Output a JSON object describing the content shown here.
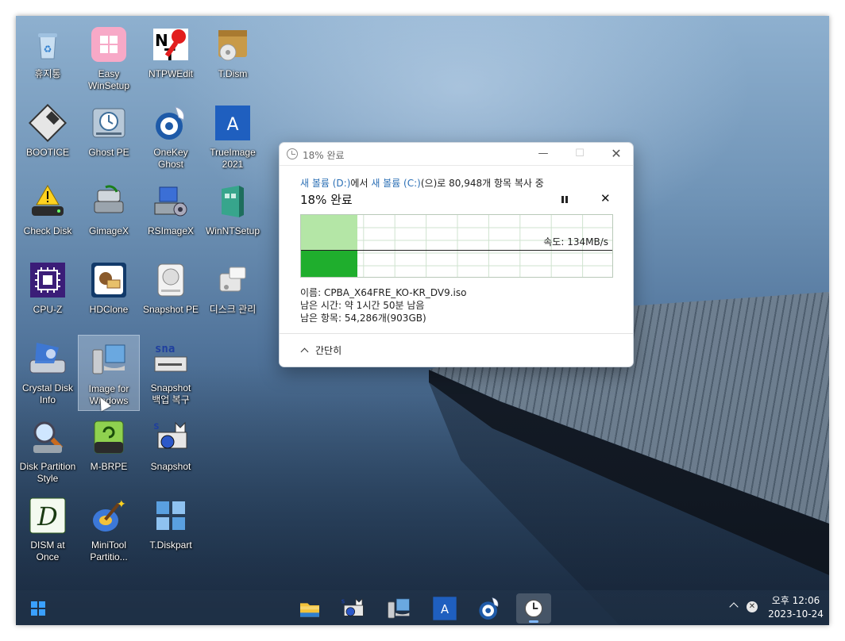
{
  "desktop": {
    "icons": [
      {
        "label": [
          "휴지통"
        ],
        "icon": "recycle-bin-icon"
      },
      {
        "label": [
          "Easy",
          "WinSetup"
        ],
        "icon": "windows-tile-icon"
      },
      {
        "label": [
          "NTPWEdit"
        ],
        "icon": "nt-key-icon"
      },
      {
        "label": [
          "T.Dism"
        ],
        "icon": "package-disc-icon"
      },
      {
        "label": [
          "BOOTICE"
        ],
        "icon": "floppy-icon"
      },
      {
        "label": [
          "Ghost PE"
        ],
        "icon": "ghost-drive-icon"
      },
      {
        "label": [
          "OneKey",
          "Ghost"
        ],
        "icon": "onekey-ghost-icon"
      },
      {
        "label": [
          "TrueImage",
          "2021"
        ],
        "icon": "acronis-icon"
      },
      {
        "label": [
          "Check Disk"
        ],
        "icon": "warning-drive-icon"
      },
      {
        "label": [
          "GimageX"
        ],
        "icon": "gimagex-icon"
      },
      {
        "label": [
          "RSImageX"
        ],
        "icon": "rsimagex-icon"
      },
      {
        "label": [
          "WinNTSetup"
        ],
        "icon": "winntsetup-icon"
      },
      {
        "label": [
          "CPU-Z"
        ],
        "icon": "cpu-chip-icon"
      },
      {
        "label": [
          "HDClone"
        ],
        "icon": "hdclone-icon"
      },
      {
        "label": [
          "Snapshot PE"
        ],
        "icon": "snapshot-drive-icon"
      },
      {
        "label": [
          "디스크 관리"
        ],
        "icon": "disk-management-icon"
      },
      {
        "label": [
          "Crystal Disk",
          "Info"
        ],
        "icon": "crystal-disk-icon"
      },
      {
        "label": [
          "Image for",
          "Windows"
        ],
        "icon": "image-for-windows-icon"
      },
      {
        "label": [
          "Snapshot",
          "백업 복구"
        ],
        "icon": "snapshot-backup-icon"
      },
      {
        "label": [
          "Disk Partition",
          "Style"
        ],
        "icon": "magnifier-disk-icon"
      },
      {
        "label": [
          "M-BRPE"
        ],
        "icon": "mbrpe-drive-icon"
      },
      {
        "label": [
          "Snapshot"
        ],
        "icon": "snapshot-camera-icon"
      },
      {
        "label": [
          "DISM at",
          "Once"
        ],
        "icon": "dism-d-icon"
      },
      {
        "label": [
          "MiniTool",
          "Partitio..."
        ],
        "icon": "minitool-wand-icon"
      },
      {
        "label": [
          "T.Diskpart"
        ],
        "icon": "diskpart-tiles-icon"
      }
    ]
  },
  "dialog": {
    "title": "18% 완료",
    "copy_source": "새 볼륨 (D:)",
    "copy_mid": "에서 ",
    "copy_dest": "새 볼륨 (C:)",
    "copy_tail": "(으)로 80,948개 항목 복사 중",
    "percent_label": "18% 완료",
    "progress_fraction": 0.18,
    "speed_label": "속도: 134MB/s",
    "name_line": "이름: CPBA_X64FRE_KO-KR_DV9.iso",
    "time_line": "남은 시간: 약 1시간 50분 남음",
    "items_line": "남은 항목: 54,286개(903GB)",
    "collapse_label": "간단히",
    "close_glyph": "✕",
    "minimize_glyph": "—",
    "maximize_glyph": "☐",
    "cancel_glyph": "✕"
  },
  "taskbar": {
    "apps": [
      "file-explorer-icon",
      "snapshot-camera-icon",
      "image-for-windows-icon",
      "acronis-icon",
      "onekey-ghost-icon",
      "copy-progress-clock-icon"
    ],
    "tray_close_glyph": "✕",
    "clock_time": "오후 12:06",
    "clock_date": "2023-10-24"
  },
  "colors": {
    "link_blue": "#2b6fb5",
    "graph_fill": "#b4e6a6",
    "graph_throughput": "#1fae2d"
  }
}
